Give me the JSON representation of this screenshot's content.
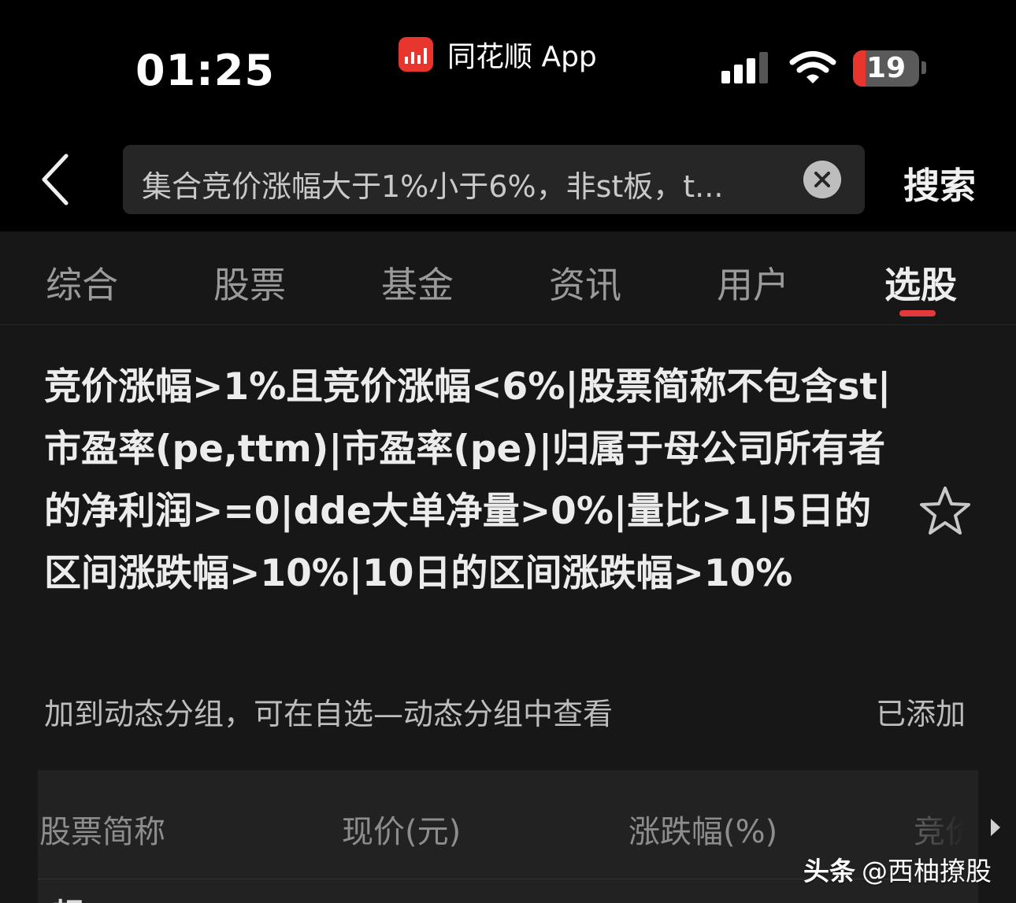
{
  "status_bar": {
    "time": "01:25",
    "app_indicator": "同花顺 App",
    "battery_level": "19",
    "battery_percent": 19
  },
  "search": {
    "query": "集合竞价涨幅大于1%小于6%，非st板，t...",
    "search_button": "搜索"
  },
  "tabs": [
    {
      "label": "综合",
      "active": false
    },
    {
      "label": "股票",
      "active": false
    },
    {
      "label": "基金",
      "active": false
    },
    {
      "label": "资讯",
      "active": false
    },
    {
      "label": "用户",
      "active": false
    },
    {
      "label": "选股",
      "active": true
    }
  ],
  "result": {
    "condition_text": "竞价涨幅>1%且竞价涨幅<6%|股票简称不包含st|市盈率(pe,ttm)|市盈率(pe)|归属于母公司所有者的净利润>=0|dde大单净量>0%|量比>1|5日的区间涨跌幅>10%|10日的区间涨跌幅>10%",
    "dynamic_group_hint": "加到动态分组，可在自选—动态分组中查看",
    "added_label": "已添加"
  },
  "table": {
    "columns": [
      "股票简称",
      "现价(元)",
      "涨跌幅(%)",
      "竞价"
    ],
    "first_row_peek": "超"
  },
  "watermark": {
    "brand": "头条",
    "handle": "@西柚撩股"
  },
  "colors": {
    "accent_red": "#e23a3a",
    "background": "#171717",
    "header_bg": "#000000"
  }
}
